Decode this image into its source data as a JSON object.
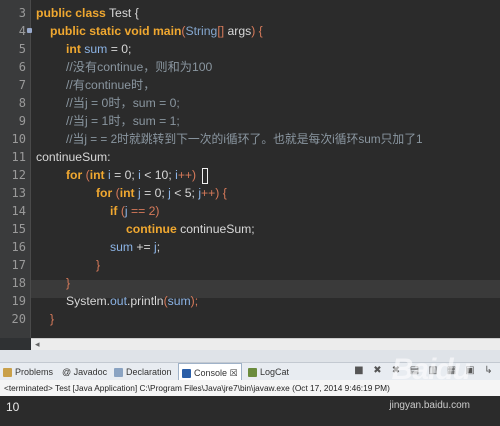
{
  "editor": {
    "lines": [
      {
        "num": "3",
        "marker": false
      },
      {
        "num": "4",
        "marker": true
      },
      {
        "num": "5",
        "marker": false
      },
      {
        "num": "6",
        "marker": false
      },
      {
        "num": "7",
        "marker": false
      },
      {
        "num": "8",
        "marker": false
      },
      {
        "num": "9",
        "marker": false
      },
      {
        "num": "10",
        "marker": false
      },
      {
        "num": "11",
        "marker": false
      },
      {
        "num": "12",
        "marker": false
      },
      {
        "num": "13",
        "marker": false
      },
      {
        "num": "14",
        "marker": false
      },
      {
        "num": "15",
        "marker": false
      },
      {
        "num": "16",
        "marker": false
      },
      {
        "num": "17",
        "marker": false
      },
      {
        "num": "18",
        "marker": false
      },
      {
        "num": "19",
        "marker": false
      },
      {
        "num": "20",
        "marker": false
      }
    ],
    "code": {
      "l3": {
        "kw1": "public",
        "kw2": "class",
        "name": "Test",
        "brace": " {"
      },
      "l4": {
        "kw1": "public",
        "kw2": "static",
        "kw3": "void",
        "fn": "main",
        "p1": "(",
        "type": "String",
        "arr": "[]",
        "arg": " args",
        "p2": ") {"
      },
      "l5": {
        "kw": "int",
        "var": "sum",
        "rest": " = 0;"
      },
      "l6": {
        "text": "//没有continue，则和为100"
      },
      "l7": {
        "text": "//有continue时，"
      },
      "l8": {
        "text": "//当j = 0时，sum = 0;"
      },
      "l9": {
        "text": "//当j = 1时，sum = 1;"
      },
      "l10": {
        "text": "//当j = = 2时就跳转到下一次的i循环了。也就是每次i循环sum只加了1"
      },
      "l11": {
        "text": "continueSum:"
      },
      "l12": {
        "kw": "for",
        "p1": " (",
        "kw2": "int",
        "v1": "i",
        "r1": " = 0; ",
        "v2": "i",
        "r2": " < 10; ",
        "v3": "i",
        "r3": "++) "
      },
      "l13": {
        "kw": "for",
        "p1": " (",
        "kw2": "int",
        "v1": "j",
        "r1": " = 0; ",
        "v2": "j",
        "r2": " < 5; ",
        "v3": "j",
        "r3": "++) {"
      },
      "l14": {
        "kw": "if",
        "p1": " (",
        "v1": "j",
        "r1": " == 2)"
      },
      "l15": {
        "kw": "continue",
        "label": " continueSum;"
      },
      "l16": {
        "v1": "sum",
        "r1": " += ",
        "v2": "j",
        "r2": ";"
      },
      "l17": {
        "text": "}"
      },
      "l18": {
        "text": "}"
      },
      "l19": {
        "cls": "System",
        "dot1": ".",
        "fld": "out",
        "dot2": ".",
        "mth": "println",
        "p1": "(",
        "v1": "sum",
        "p2": ");"
      },
      "l20": {
        "text": "}"
      }
    }
  },
  "tabs": [
    {
      "label": "Problems",
      "icon": "problems-icon"
    },
    {
      "label": "@ Javadoc",
      "icon": "javadoc-icon"
    },
    {
      "label": "Declaration",
      "icon": "declaration-icon"
    },
    {
      "label": "Console",
      "icon": "console-icon",
      "close": "☒"
    },
    {
      "label": "LogCat",
      "icon": "logcat-icon"
    }
  ],
  "status_line": "<terminated> Test [Java Application] C:\\Program Files\\Java\\jre7\\bin\\javaw.exe (Oct 17, 2014 9:46:19 PM)",
  "console_output": "10",
  "watermark": {
    "logo": "Baidu",
    "url": "jingyan.baidu.com"
  },
  "colors": {
    "keyword": "#f0a830",
    "variable": "#8cb4e6",
    "comment": "#8a96a0",
    "background": "#2b2b2b"
  }
}
